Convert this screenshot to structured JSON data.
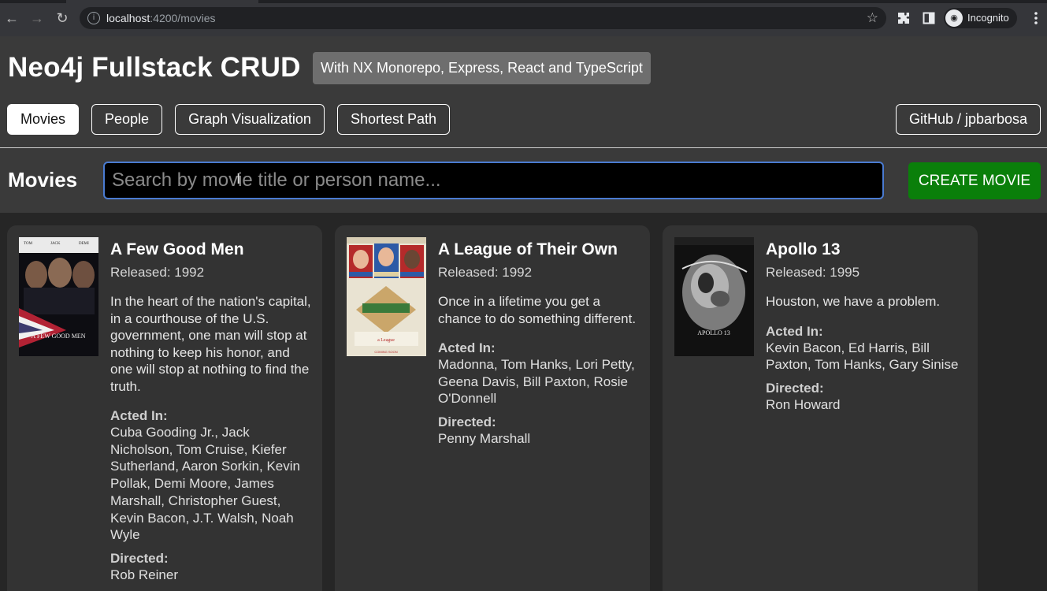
{
  "browser": {
    "url_host": "localhost",
    "url_path": ":4200/movies",
    "profile_label": "Incognito"
  },
  "app": {
    "title": "Neo4j Fullstack CRUD",
    "subtitle": "With NX Monorepo, Express, React and TypeScript"
  },
  "nav": {
    "movies": "Movies",
    "people": "People",
    "graph": "Graph Visualization",
    "shortest": "Shortest Path",
    "github": "GitHub / jpbarbosa"
  },
  "toolbar": {
    "section_title": "Movies",
    "search_placeholder": "Search by movie title or person name...",
    "create_label": "CREATE MOVIE"
  },
  "labels": {
    "acted_in": "Acted In:",
    "directed": "Directed:"
  },
  "movies": [
    {
      "title": "A Few Good Men",
      "released": "Released: 1992",
      "tagline": "In the heart of the nation's capital, in a courthouse of the U.S. government, one man will stop at nothing to keep his honor, and one will stop at nothing to find the truth.",
      "actors": "Cuba Gooding Jr., Jack Nicholson, Tom Cruise, Kiefer Sutherland, Aaron Sorkin, Kevin Pollak, Demi Moore, James Marshall, Christopher Guest, Kevin Bacon, J.T. Walsh, Noah Wyle",
      "directors": "Rob Reiner"
    },
    {
      "title": "A League of Their Own",
      "released": "Released: 1992",
      "tagline": "Once in a lifetime you get a chance to do something different.",
      "actors": "Madonna, Tom Hanks, Lori Petty, Geena Davis, Bill Paxton, Rosie O'Donnell",
      "directors": "Penny Marshall"
    },
    {
      "title": "Apollo 13",
      "released": "Released: 1995",
      "tagline": "Houston, we have a problem.",
      "actors": "Kevin Bacon, Ed Harris, Bill Paxton, Tom Hanks, Gary Sinise",
      "directors": "Ron Howard"
    }
  ]
}
